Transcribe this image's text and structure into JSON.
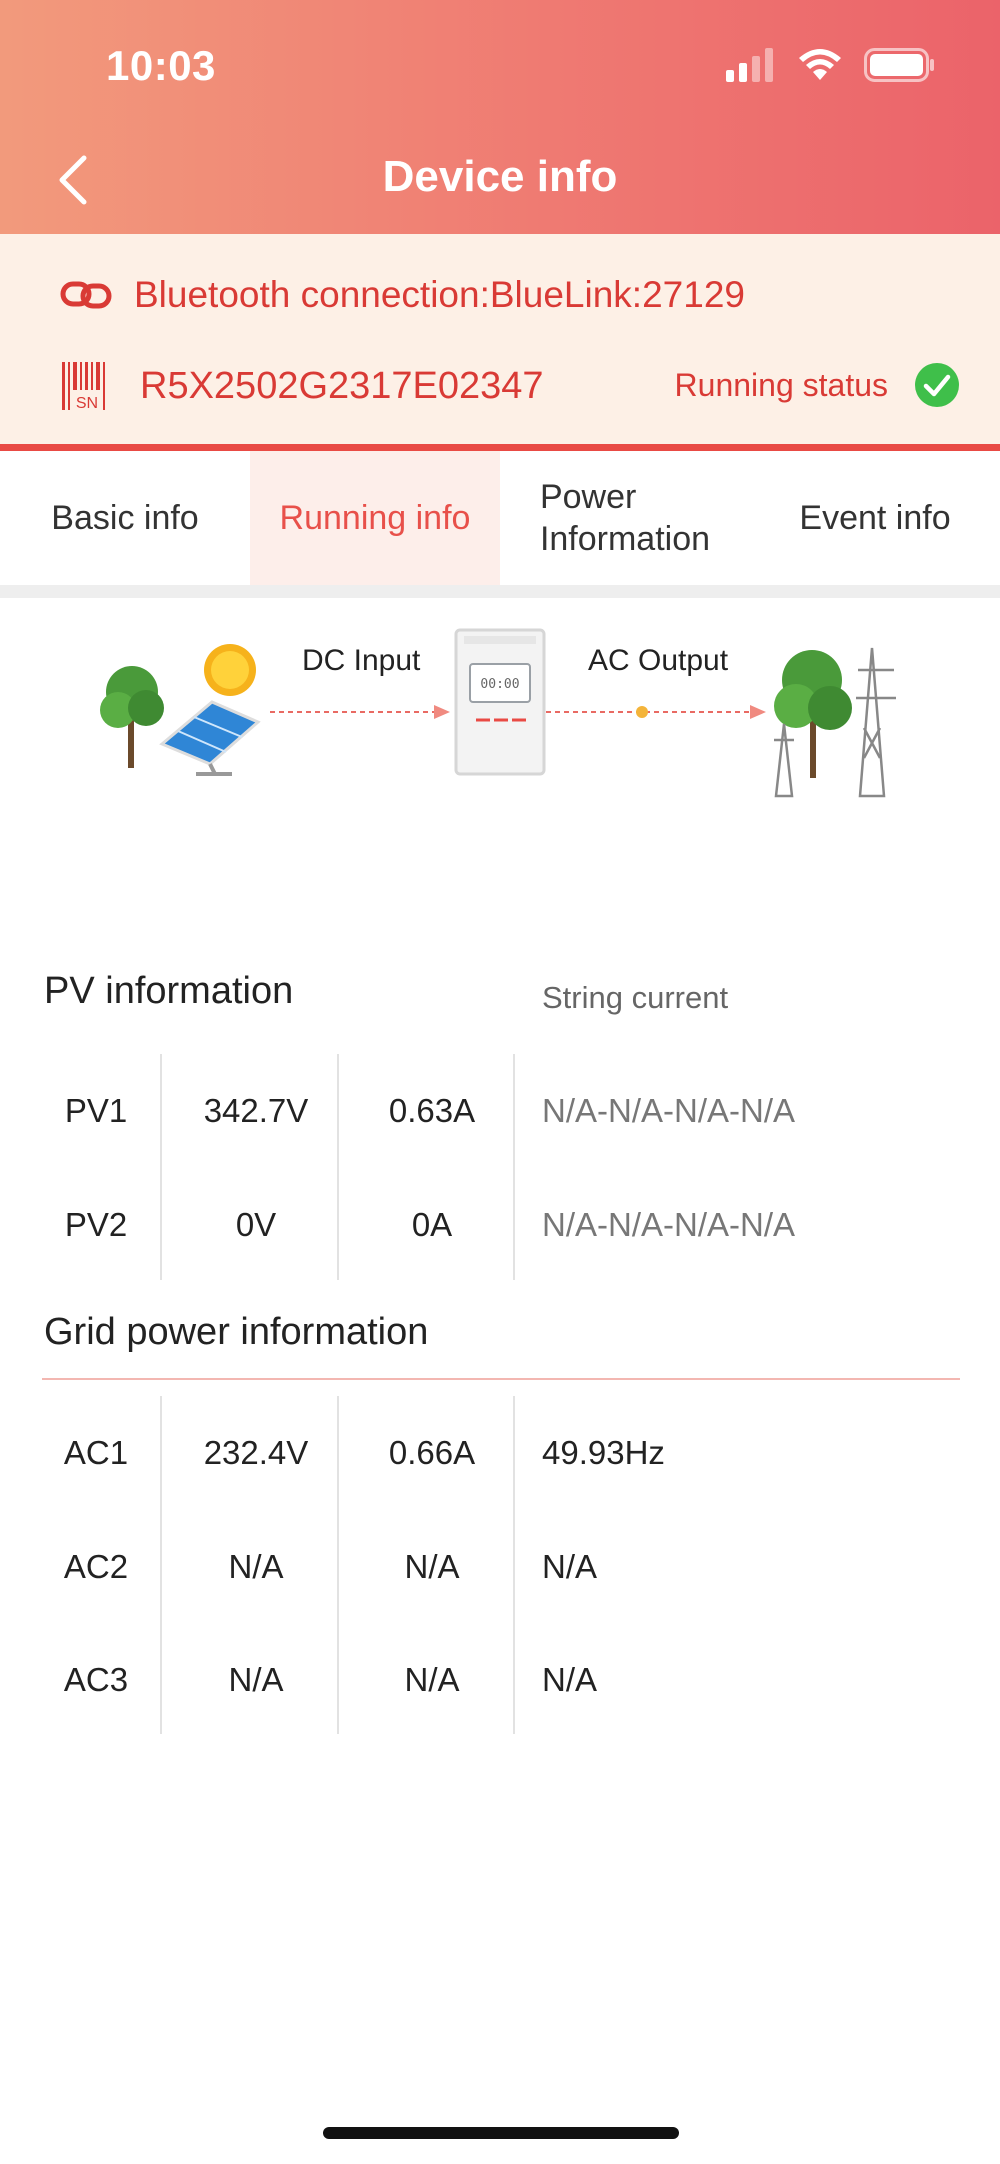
{
  "status_bar": {
    "time": "10:03"
  },
  "header": {
    "title": "Device info"
  },
  "device": {
    "bluetooth_text": "Bluetooth connection:BlueLink:27129",
    "serial": "R5X2502G2317E02347",
    "sn_icon_text": "SN",
    "status_label": "Running status"
  },
  "tabs": [
    {
      "label": "Basic info"
    },
    {
      "label": "Running info"
    },
    {
      "label_line1": "Power",
      "label_line2": "Information"
    },
    {
      "label": "Event info"
    }
  ],
  "diagram": {
    "dc_label": "DC Input",
    "ac_label": "AC Output",
    "inverter_display": "00:00"
  },
  "pv": {
    "title": "PV information",
    "string_current_label": "String current",
    "rows": [
      {
        "name": "PV1",
        "voltage": "342.7V",
        "current": "0.63A",
        "string": "N/A-N/A-N/A-N/A"
      },
      {
        "name": "PV2",
        "voltage": "0V",
        "current": "0A",
        "string": "N/A-N/A-N/A-N/A"
      }
    ]
  },
  "grid": {
    "title": "Grid power information",
    "rows": [
      {
        "name": "AC1",
        "voltage": "232.4V",
        "current": "0.66A",
        "freq": "49.93Hz"
      },
      {
        "name": "AC2",
        "voltage": "N/A",
        "current": "N/A",
        "freq": "N/A"
      },
      {
        "name": "AC3",
        "voltage": "N/A",
        "current": "N/A",
        "freq": "N/A"
      }
    ]
  },
  "colors": {
    "accent": "#e8504a",
    "status_ok": "#3fbf4a",
    "header_start": "#f29a7c",
    "header_end": "#eb636a"
  },
  "icons": [
    "back-chevron-icon",
    "signal-icon",
    "wifi-icon",
    "battery-icon",
    "link-icon",
    "barcode-sn-icon",
    "check-circle-icon",
    "solar-panel-icon",
    "inverter-icon",
    "power-tower-icon"
  ]
}
